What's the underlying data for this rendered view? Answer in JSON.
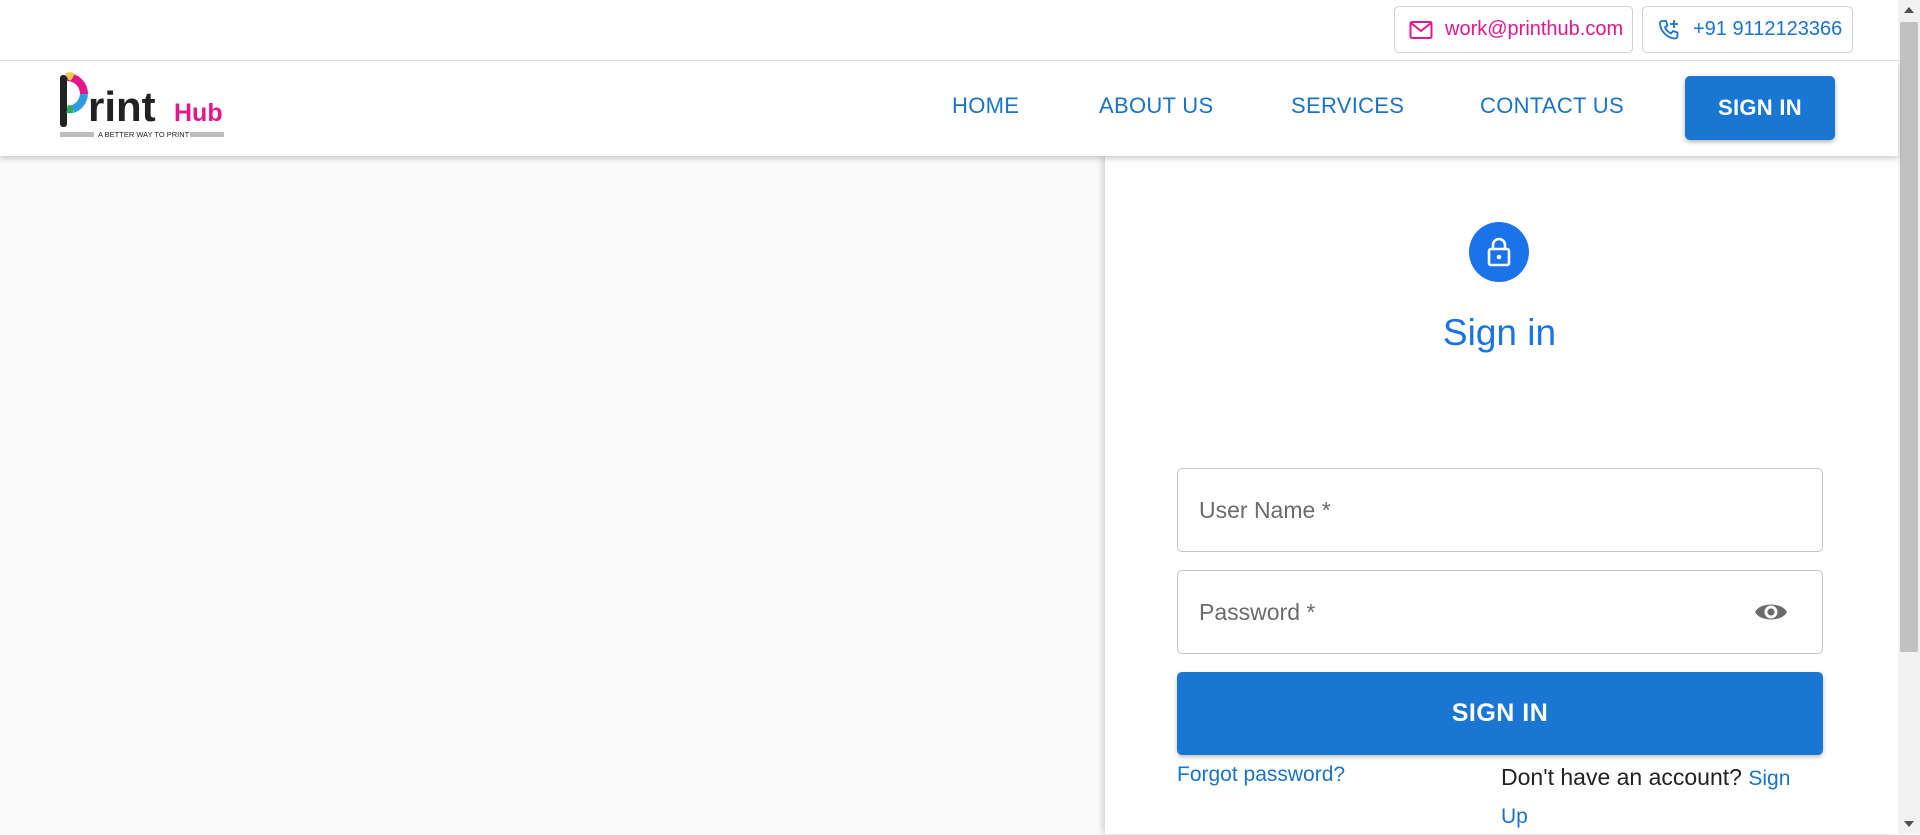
{
  "contact": {
    "email": "work@printhub.com",
    "phone": "+91 9112123366"
  },
  "logo": {
    "word": "rint",
    "accent": "Hub",
    "tagline": "A BETTER WAY TO PRINT"
  },
  "nav": {
    "home": "HOME",
    "about": "ABOUT US",
    "services": "SERVICES",
    "contact": "CONTACT US",
    "signin": "SIGN IN"
  },
  "form": {
    "title": "Sign in",
    "username_placeholder": "User Name *",
    "password_placeholder": "Password *",
    "submit": "SIGN IN",
    "forgot": "Forgot password?",
    "no_account": "Don't have an account? ",
    "signup": "Sign Up"
  },
  "icons": {
    "email": "mail-icon",
    "phone": "phone-add-icon",
    "lock": "lock-icon",
    "password_toggle": "eye-icon"
  },
  "colors": {
    "primary": "#1976d2",
    "title_blue": "#1a73e8",
    "brand_pink": "#e3178d"
  }
}
